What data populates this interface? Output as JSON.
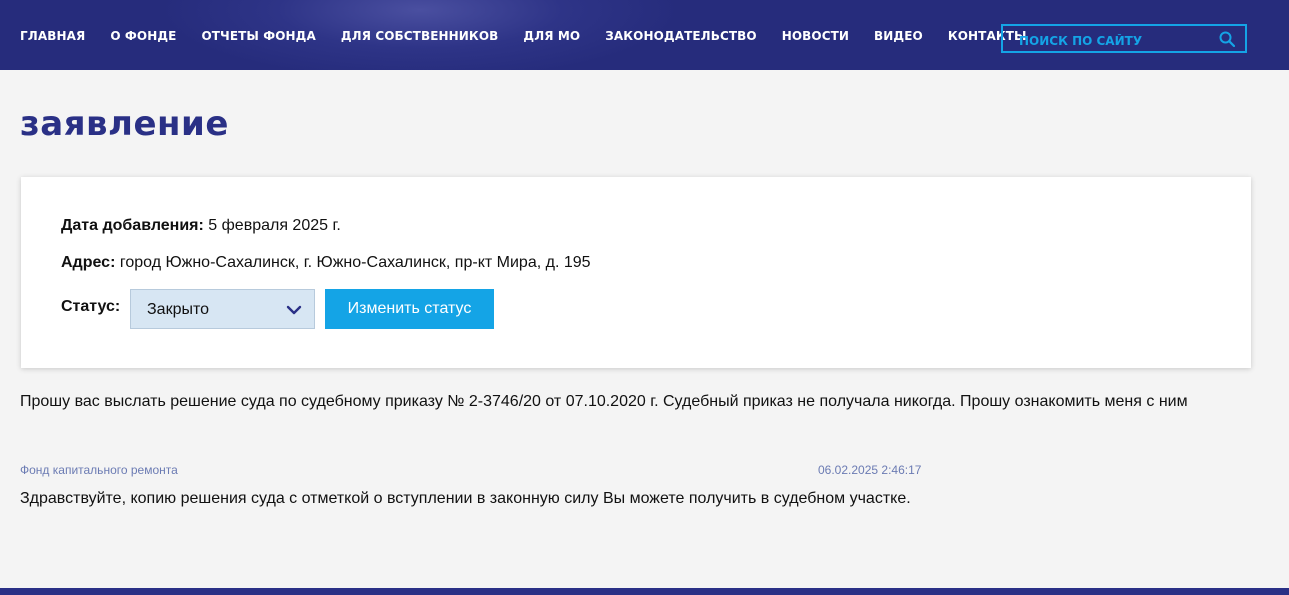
{
  "nav": {
    "items": [
      "ГЛАВНАЯ",
      "О ФОНДЕ",
      "ОТЧЕТЫ ФОНДА",
      "ДЛЯ СОБСТВЕННИКОВ",
      "ДЛЯ МО",
      "ЗАКОНОДАТЕЛЬСТВО",
      "НОВОСТИ",
      "ВИДЕО",
      "КОНТАКТЫ"
    ],
    "search_placeholder": "ПОИСК ПО САЙТУ",
    "search_icon": "search-icon"
  },
  "page": {
    "title": "заявление"
  },
  "card": {
    "date_label": "Дата добавления:",
    "date_value": "5 февраля 2025 г.",
    "address_label": "Адрес:",
    "address_value": "город Южно-Сахалинск, г. Южно-Сахалинск, пр-кт Мира, д. 195",
    "status_label": "Статус:",
    "status_value": "Закрыто",
    "change_button": "Изменить статус"
  },
  "request_text": "Прошу вас выслать решение суда по судебному приказу № 2-3746/20 от 07.10.2020 г. Судебный приказ не получала никогда. Прошу ознакомить меня с ним",
  "reply": {
    "author": "Фонд капитального ремонта",
    "datetime": "06.02.2025 2:46:17",
    "text": "Здравствуйте, копию решения суда с отметкой о вступлении в законную силу Вы можете получить в судебном участке."
  },
  "colors": {
    "header_bg": "#2e3487",
    "accent": "#14a4e6",
    "title": "#2a3086",
    "meta": "#6b7bb3"
  }
}
